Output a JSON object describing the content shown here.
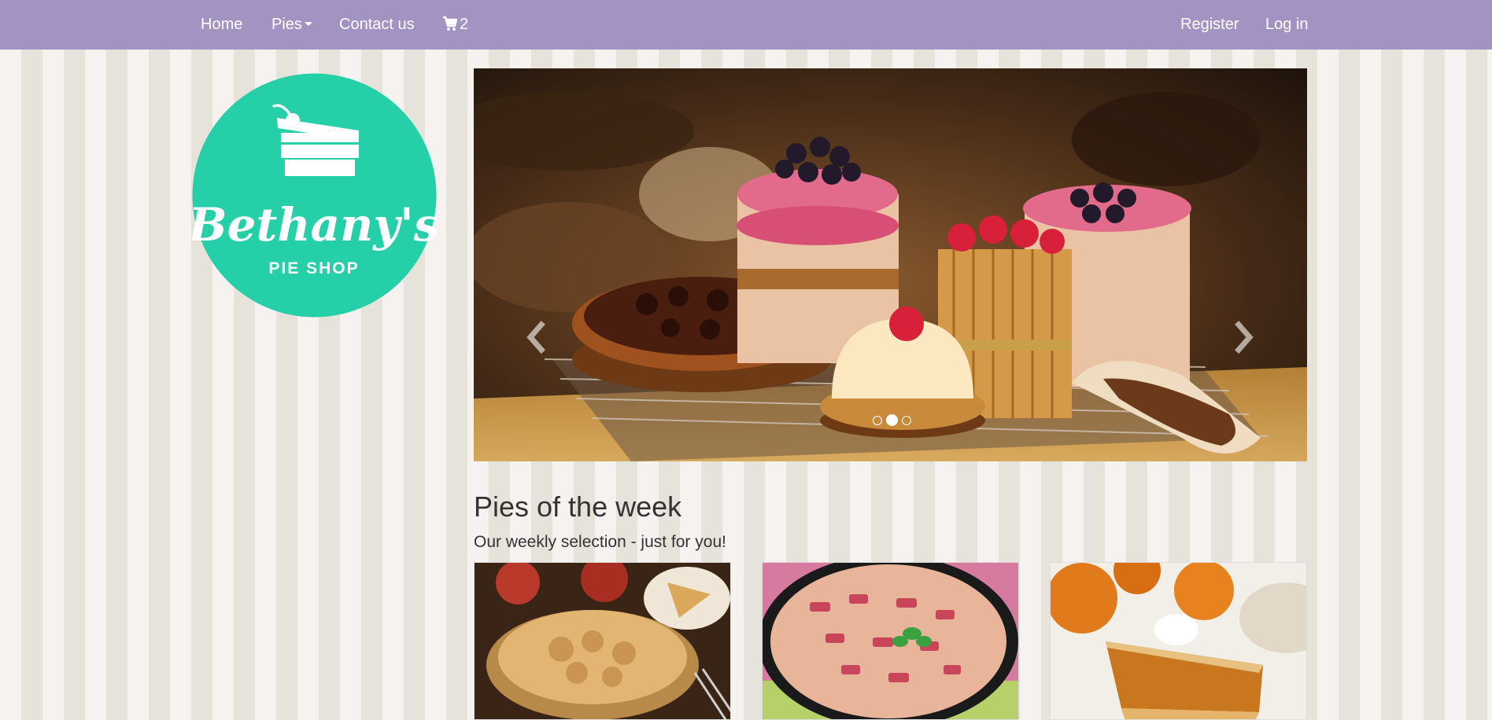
{
  "navbar": {
    "home": "Home",
    "pies": "Pies",
    "contact": "Contact us",
    "cart_count": "2",
    "register": "Register",
    "login": "Log in"
  },
  "logo": {
    "name": "Bethany's",
    "subtitle": "PIE SHOP"
  },
  "carousel": {
    "slides": 3,
    "active_slide": 2
  },
  "section": {
    "title": "Pies of the week",
    "subtitle": "Our weekly selection - just for you!"
  },
  "colors": {
    "navbar": "#a393c3",
    "logo_circle": "#25cfa8",
    "stripe_light": "#f5f2ef",
    "stripe_dark": "#e6e3db"
  }
}
